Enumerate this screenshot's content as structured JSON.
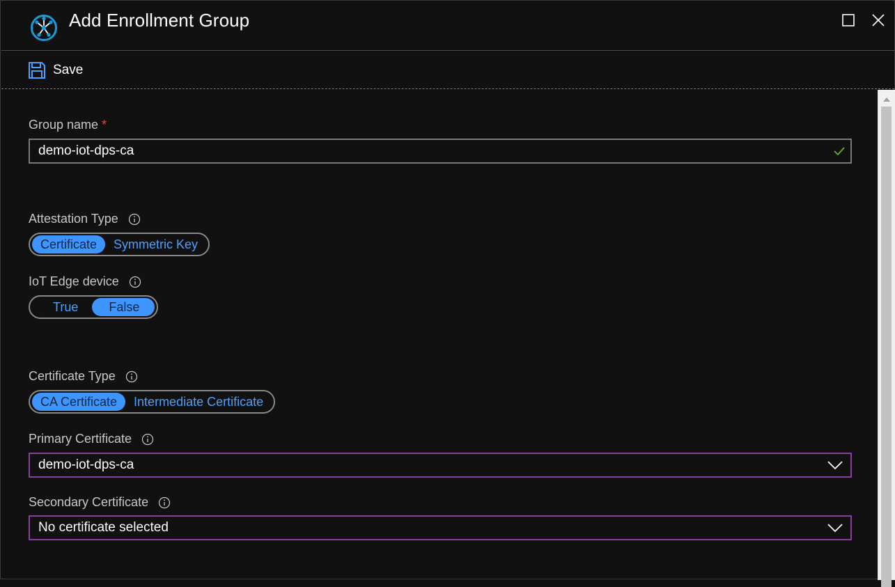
{
  "window": {
    "title": "Add Enrollment Group",
    "icon": "dps-hub-icon",
    "accent": "#1a9bd7"
  },
  "toolbar": {
    "save_label": "Save"
  },
  "form": {
    "group_name": {
      "label": "Group name",
      "required_mark": "*",
      "value": "demo-iot-dps-ca",
      "valid": true
    },
    "attestation_type": {
      "label": "Attestation Type",
      "options": [
        "Certificate",
        "Symmetric Key"
      ],
      "selected": "Certificate"
    },
    "iot_edge": {
      "label": "IoT Edge device",
      "options": [
        "True",
        "False"
      ],
      "selected": "False"
    },
    "certificate_type": {
      "label": "Certificate Type",
      "options": [
        "CA Certificate",
        "Intermediate Certificate"
      ],
      "selected": "CA Certificate"
    },
    "primary_certificate": {
      "label": "Primary Certificate",
      "value": "demo-iot-dps-ca"
    },
    "secondary_certificate": {
      "label": "Secondary Certificate",
      "value": "No certificate selected"
    }
  },
  "colors": {
    "background": "#111111",
    "toggle_selected": "#3f95ff",
    "toggle_text": "#4aa0ff",
    "select_border": "#8a3fa0",
    "required": "#e74c3c",
    "valid_check": "#5fb336"
  }
}
